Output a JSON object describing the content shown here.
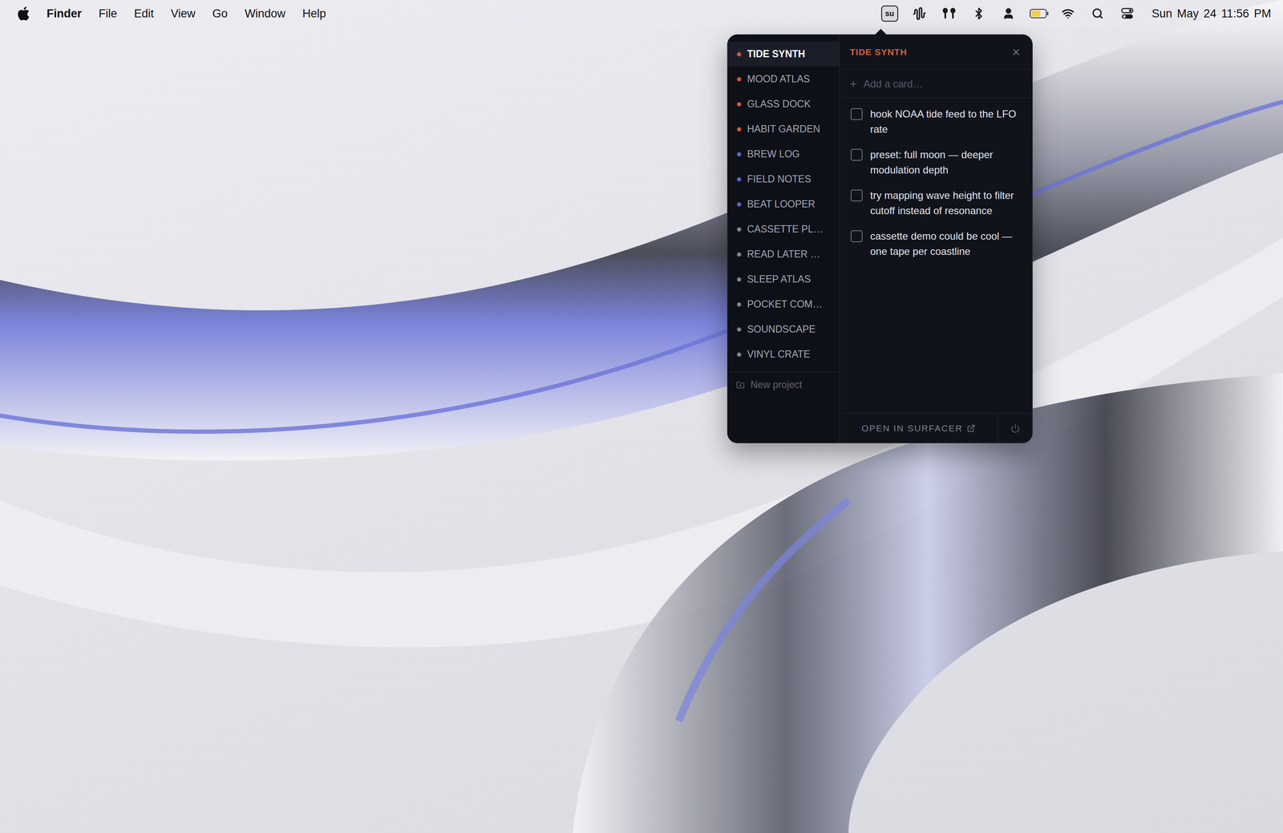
{
  "menubar": {
    "app": "Finder",
    "menus": [
      "File",
      "Edit",
      "View",
      "Go",
      "Window",
      "Help"
    ],
    "status_badge": "su",
    "date": "Sun May 24",
    "time": "11:56 PM",
    "battery": {
      "level": 0.65
    }
  },
  "popover": {
    "projects": [
      {
        "name": "TIDE SYNTH",
        "color": "#d0573a",
        "selected": true
      },
      {
        "name": "MOOD ATLAS",
        "color": "#d0573a",
        "selected": false
      },
      {
        "name": "GLASS DOCK",
        "color": "#d0573a",
        "selected": false
      },
      {
        "name": "HABIT GARDEN",
        "color": "#d0573a",
        "selected": false
      },
      {
        "name": "BREW LOG",
        "color": "#5a63cf",
        "selected": false
      },
      {
        "name": "FIELD NOTES",
        "color": "#5a63cf",
        "selected": false
      },
      {
        "name": "BEAT LOOPER",
        "color": "#5a63cf",
        "selected": false
      },
      {
        "name": "CASSETTE PL…",
        "color": "#7f8494",
        "selected": false
      },
      {
        "name": "READ LATER …",
        "color": "#7f8494",
        "selected": false
      },
      {
        "name": "SLEEP ATLAS",
        "color": "#7f8494",
        "selected": false
      },
      {
        "name": "POCKET COM…",
        "color": "#7f8494",
        "selected": false
      },
      {
        "name": "SOUNDSCAPE",
        "color": "#7f8494",
        "selected": false
      },
      {
        "name": "VINYL CRATE",
        "color": "#7f8494",
        "selected": false
      }
    ],
    "new_project": "New project",
    "title": "TIDE SYNTH",
    "add_card": {
      "icon": "+",
      "placeholder": "Add a card…"
    },
    "cards": [
      {
        "text": "hook NOAA tide feed to the LFO rate",
        "checked": false
      },
      {
        "text": "preset: full moon — deeper modulation depth",
        "checked": false
      },
      {
        "text": "try mapping wave height to filter cutoff instead of resonance",
        "checked": false
      },
      {
        "text": "cassette demo could be cool — one tape per coastline",
        "checked": false
      }
    ],
    "footer": {
      "open": "OPEN IN SURFACER"
    }
  }
}
